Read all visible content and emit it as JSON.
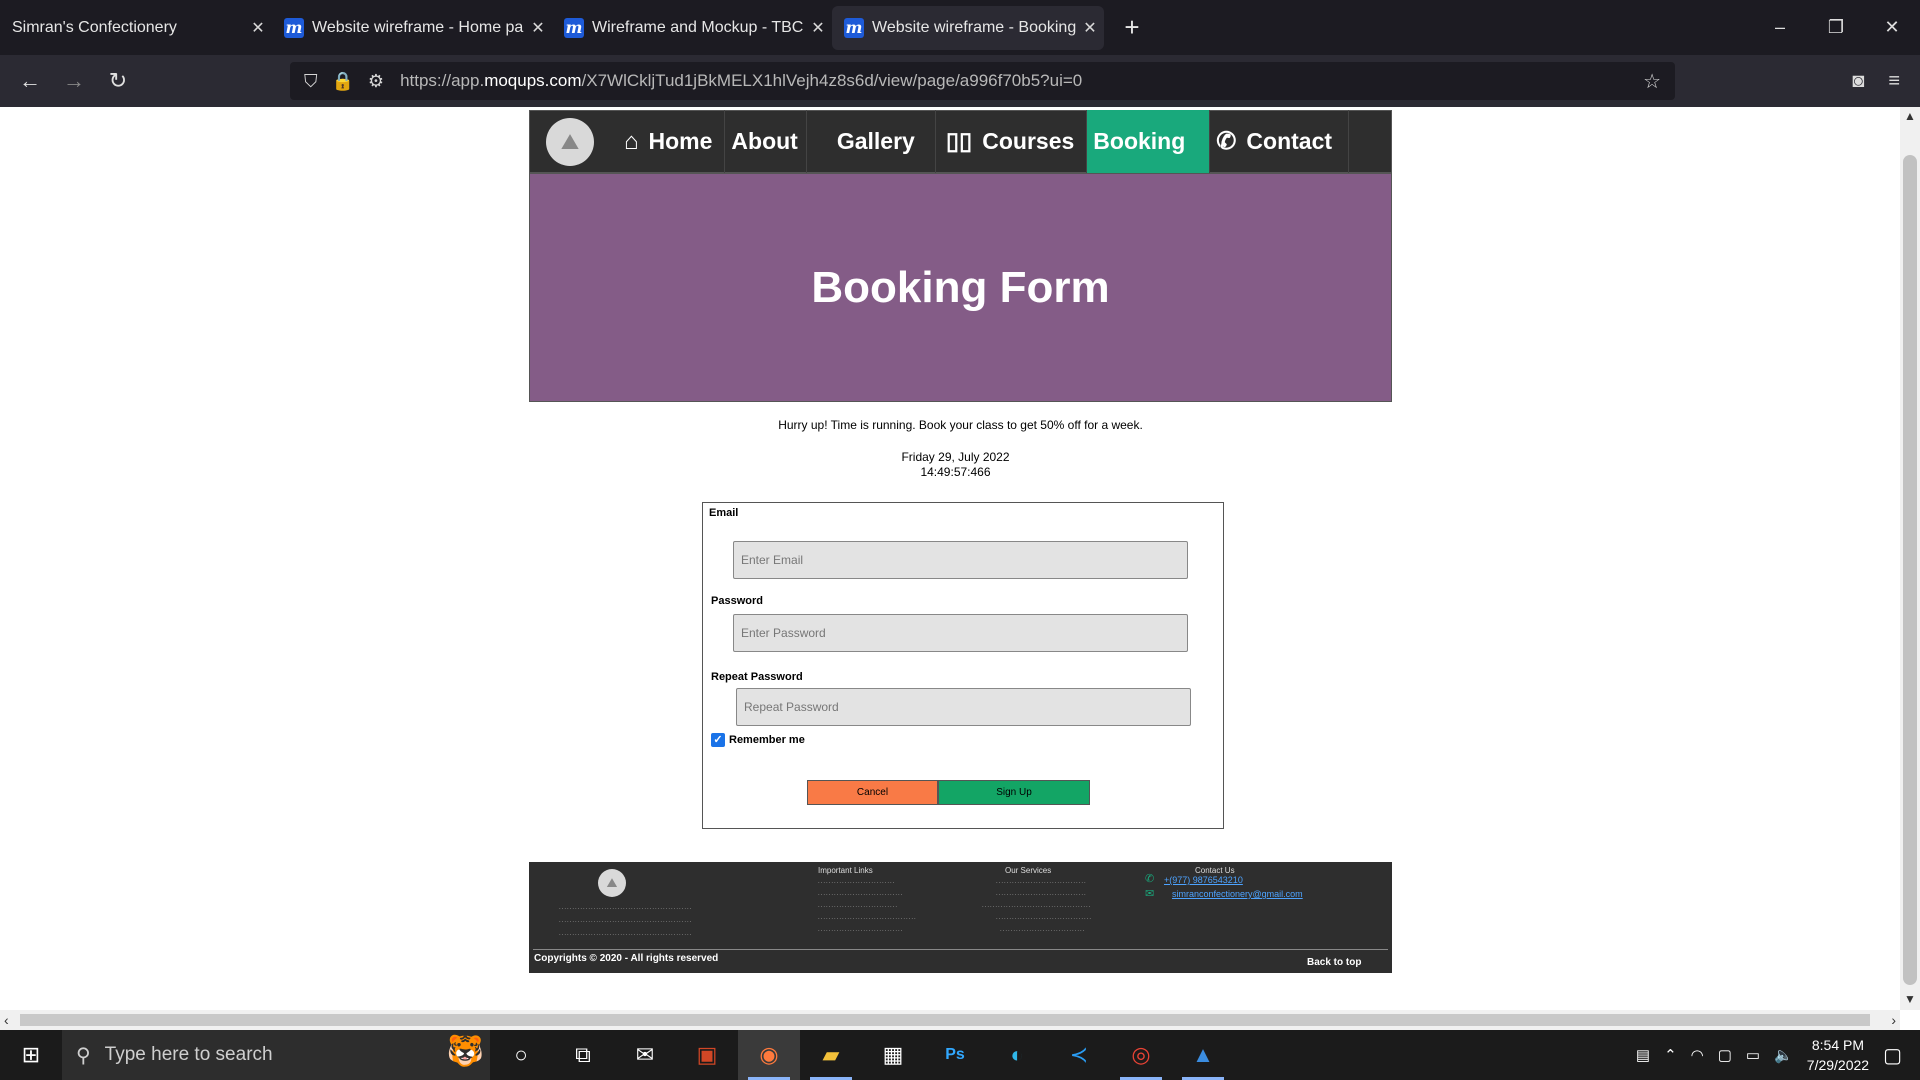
{
  "browser": {
    "tabs": [
      {
        "title": "Simran's Confectionery",
        "has_icon": false
      },
      {
        "title": "Website wireframe - Home page",
        "has_icon": true
      },
      {
        "title": "Wireframe and Mockup - TBC w",
        "has_icon": true
      },
      {
        "title": "Website wireframe - Booking pa",
        "has_icon": true,
        "active": true
      }
    ],
    "new_tab": "+",
    "url_prefix": "https://app.",
    "url_domain": "moqups.com",
    "url_rest": "/X7WlCkljTud1jBkMELX1hlVejh4z8s6d/view/page/a996f70b5?ui=0",
    "window_controls": [
      "–",
      "❐",
      "✕"
    ]
  },
  "site": {
    "nav": [
      {
        "label": "Home",
        "icon": "home-icon",
        "glyph": "🏠"
      },
      {
        "label": "About",
        "icon": "",
        "glyph": ""
      },
      {
        "label": "Gallery",
        "icon": "",
        "glyph": ""
      },
      {
        "label": "Courses",
        "icon": "book-icon",
        "glyph": "📖"
      },
      {
        "label": "Booking",
        "icon": "",
        "glyph": "",
        "active": true
      },
      {
        "label": "Contact",
        "icon": "phone-icon",
        "glyph": "📞"
      }
    ],
    "hero_title": "Booking Form",
    "promo": "Hurry up! Time is running. Book your class to get 50% off for a week.",
    "date": "Friday 29, July 2022",
    "time": "14:49:57:466",
    "form": {
      "email_label": "Email",
      "email_placeholder": "Enter Email",
      "password_label": "Password",
      "password_placeholder": "Enter Password",
      "repeat_label": "Repeat Password",
      "repeat_placeholder": "Repeat Password",
      "remember_label": "Remember me",
      "remember_checked": true,
      "cancel_label": "Cancel",
      "signup_label": "Sign Up"
    },
    "footer": {
      "important_links": "Important Links",
      "our_services": "Our Services",
      "contact_us": "Contact Us",
      "phone": "+(977) 9876543210",
      "email": "simranconfectionery@gmail.com",
      "copyright": "Copyrights © 2020 - All rights reserved",
      "back_to_top": "Back to top"
    }
  },
  "taskbar": {
    "search_placeholder": "Type here to search",
    "time": "8:54 PM",
    "date": "7/29/2022"
  },
  "colors": {
    "nav_bg": "#2e2e2e",
    "active_nav": "#19a97c",
    "hero_bg": "#845c87",
    "cancel": "#f97a46",
    "signup": "#13a565"
  }
}
